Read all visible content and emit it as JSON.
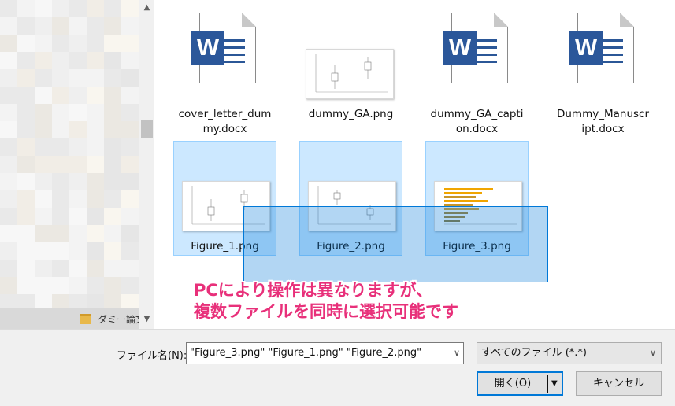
{
  "nav": {
    "folder_label": "ダミー論文"
  },
  "files": [
    {
      "name": "cover_letter_dummy.docx",
      "line1": "cover_letter_dum",
      "line2": "my.docx",
      "type": "docx",
      "selected": false
    },
    {
      "name": "dummy_GA.png",
      "line1": "dummy_GA.png",
      "line2": "",
      "type": "png",
      "selected": false
    },
    {
      "name": "dummy_GA_caption.docx",
      "line1": "dummy_GA_capti",
      "line2": "on.docx",
      "type": "docx",
      "selected": false
    },
    {
      "name": "Dummy_Manuscript.docx",
      "line1": "Dummy_Manuscr",
      "line2": "ipt.docx",
      "type": "docx",
      "selected": false
    },
    {
      "name": "Figure_1.png",
      "line1": "Figure_1.png",
      "line2": "",
      "type": "png",
      "selected": true
    },
    {
      "name": "Figure_2.png",
      "line1": "Figure_2.png",
      "line2": "",
      "type": "png",
      "selected": true
    },
    {
      "name": "Figure_3.png",
      "line1": "Figure_3.png",
      "line2": "",
      "type": "png",
      "selected": true
    }
  ],
  "icons": {
    "word": "word-doc-icon",
    "thumbnail": "image-thumbnail-icon"
  },
  "annotation": {
    "line1": "PCにより操作は異なりますが、",
    "line2": "複数ファイルを同時に選択可能です",
    "color": "#e8307a"
  },
  "bottom": {
    "filename_label": "ファイル名(N):",
    "filename_value": "\"Figure_3.png\" \"Figure_1.png\" \"Figure_2.png\"",
    "filetype_value": "すべてのファイル (*.*)",
    "open_label": "開く(O)",
    "cancel_label": "キャンセル"
  },
  "colors": {
    "selection": "#cce8ff",
    "accent": "#0078d7",
    "word_blue": "#2b579a"
  }
}
